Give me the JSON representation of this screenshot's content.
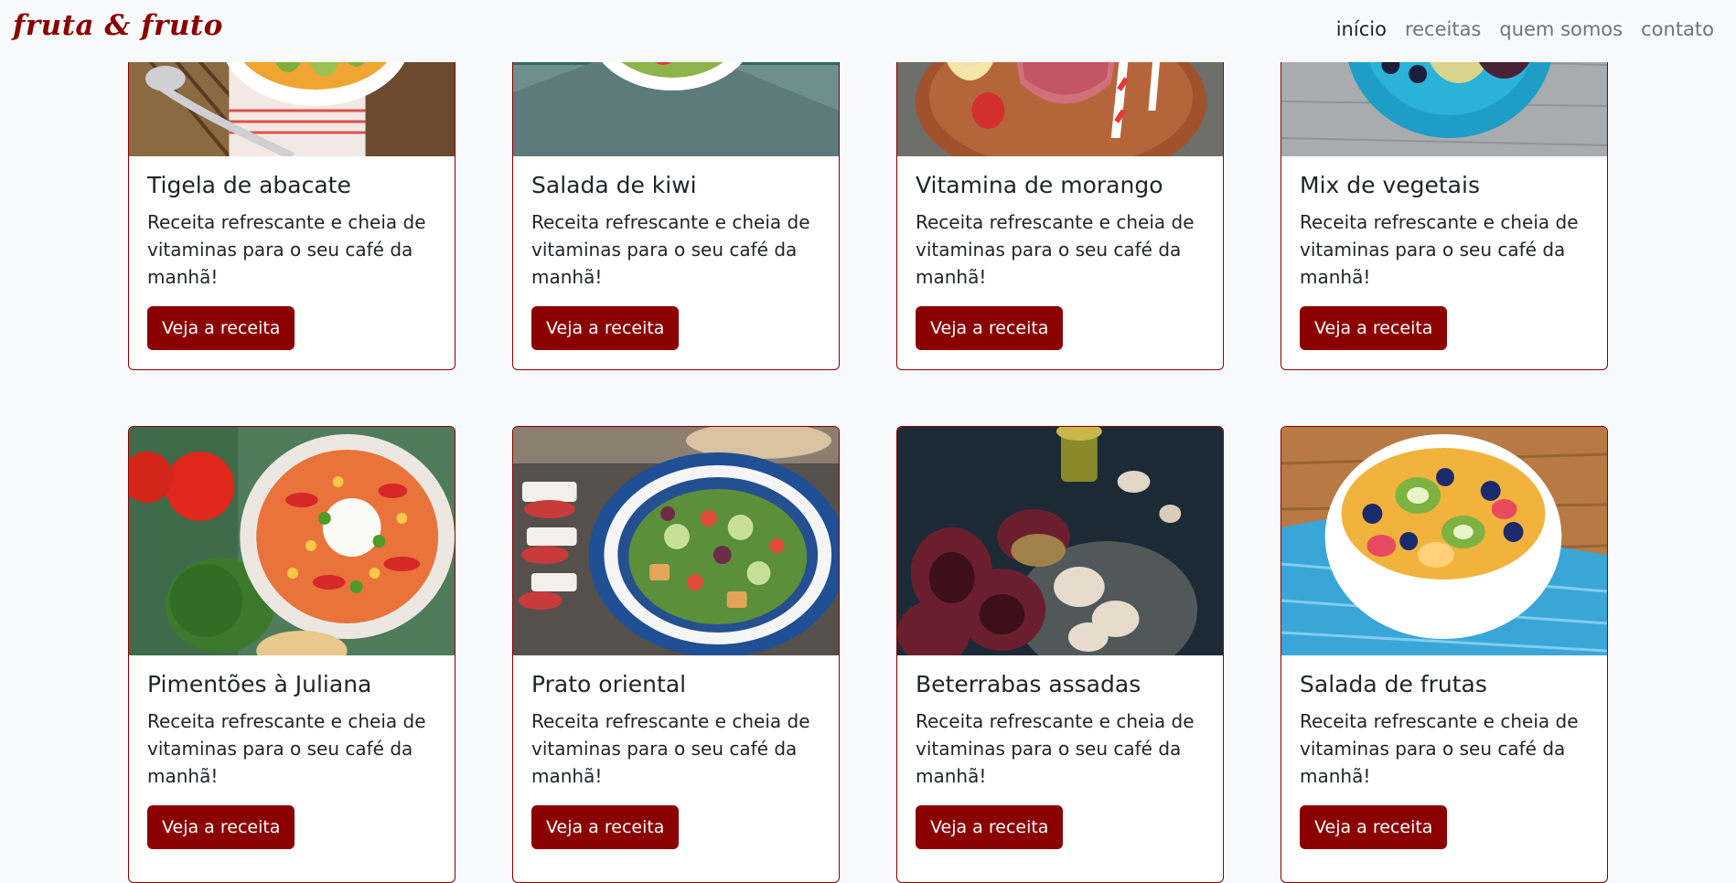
{
  "navbar": {
    "brand": "fruta & fruto",
    "links": [
      "início",
      "receitas",
      "quem somos",
      "contato"
    ],
    "active_link": "início"
  },
  "colors": {
    "accent": "#8b0000",
    "background": "#f8f9fa"
  },
  "recipes": [
    {
      "title": "Tigela de abacate",
      "text": "Receita refrescante e cheia de vitaminas para o seu café da manhã!",
      "button": "Veja a receita",
      "image": "avocado-bowl-photo"
    },
    {
      "title": "Salada de kiwi",
      "text": "Receita refrescante e cheia de vitaminas para o seu café da manhã!",
      "button": "Veja a receita",
      "image": "kiwi-salad-photo"
    },
    {
      "title": "Vitamina de morango",
      "text": "Receita refrescante e cheia de vitaminas para o seu café da manhã!",
      "button": "Veja a receita",
      "image": "strawberry-smoothie-photo"
    },
    {
      "title": "Mix de vegetais",
      "text": "Receita refrescante e cheia de vitaminas para o seu café da manhã!",
      "button": "Veja a receita",
      "image": "vegetable-mix-photo"
    },
    {
      "title": "Pimentões à Juliana",
      "text": "Receita refrescante e cheia de vitaminas para o seu café da manhã!",
      "button": "Veja a receita",
      "image": "peppers-plate-photo"
    },
    {
      "title": "Prato oriental",
      "text": "Receita refrescante e cheia de vitaminas para o seu café da manhã!",
      "button": "Veja a receita",
      "image": "oriental-salad-photo"
    },
    {
      "title": "Beterrabas assadas",
      "text": "Receita refrescante e cheia de vitaminas para o seu café da manhã!",
      "button": "Veja a receita",
      "image": "roasted-beets-photo"
    },
    {
      "title": "Salada de frutas",
      "text": "Receita refrescante e cheia de vitaminas para o seu café da manhã!",
      "button": "Veja a receita",
      "image": "fruit-salad-photo"
    }
  ]
}
